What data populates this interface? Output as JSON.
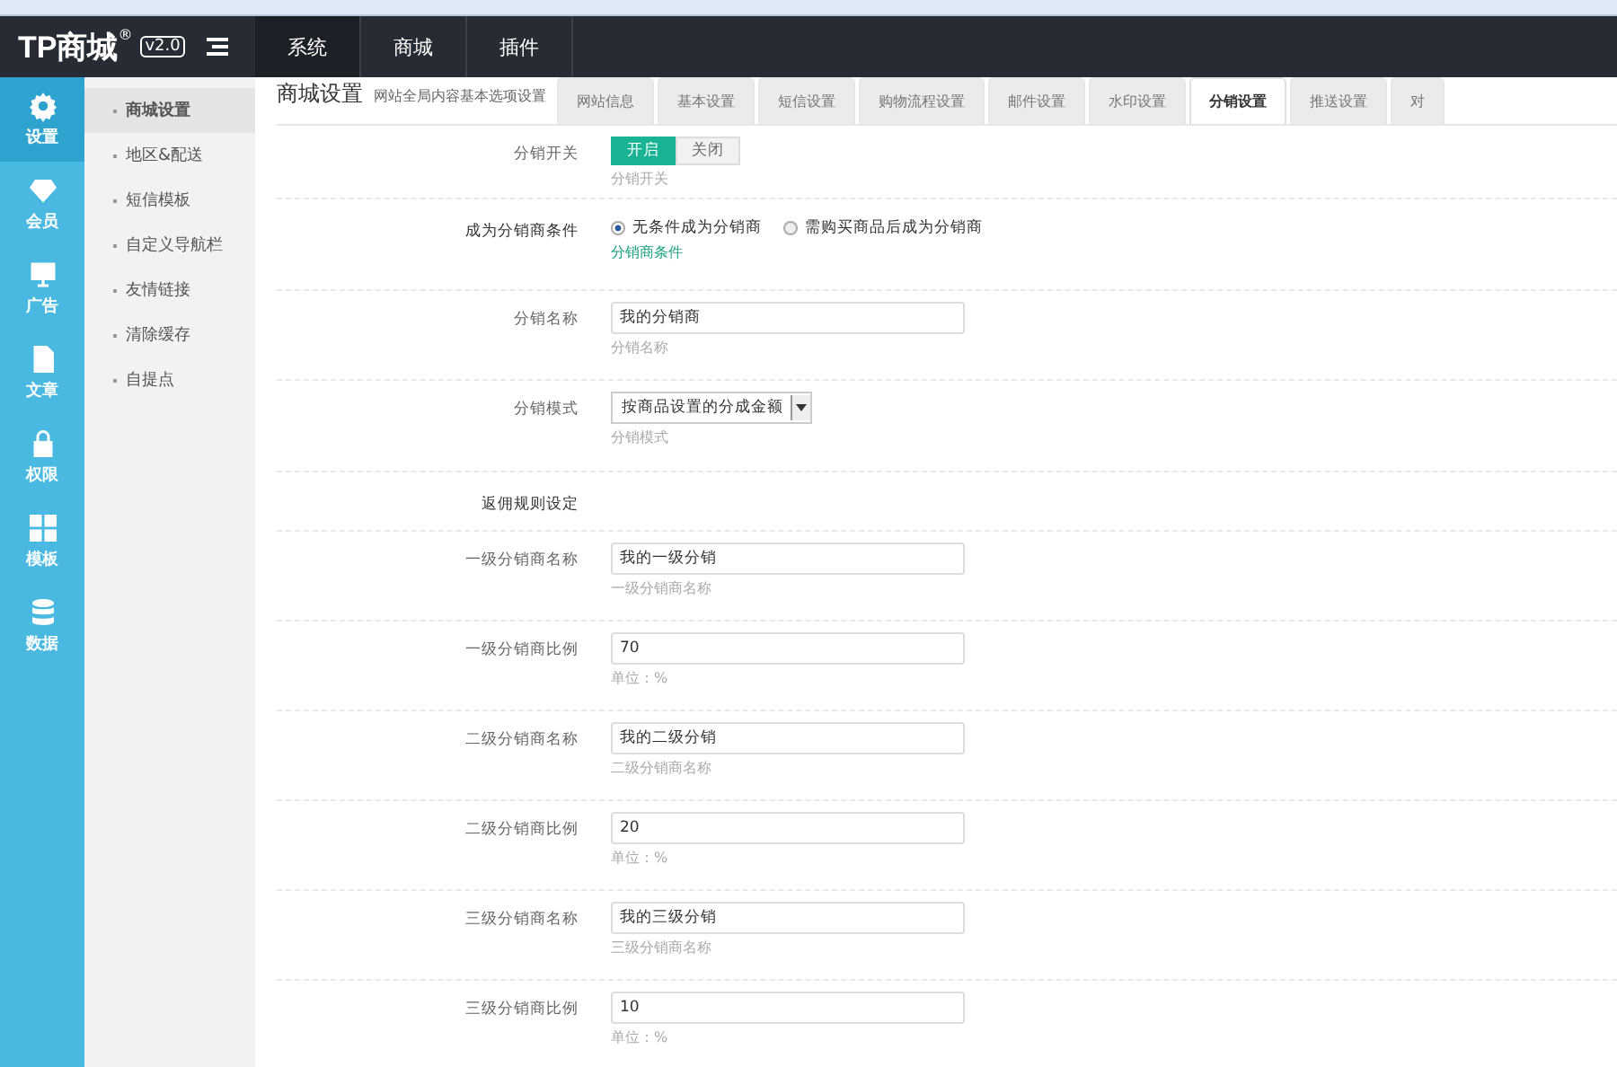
{
  "topbar": {
    "logo": "TP商城",
    "logo_mark": "®",
    "version": "v2.0",
    "menu": [
      {
        "label": "系统",
        "selected": true
      },
      {
        "label": "商城",
        "selected": false
      },
      {
        "label": "插件",
        "selected": false
      }
    ]
  },
  "iconbar": [
    {
      "label": "设置",
      "selected": true
    },
    {
      "label": "会员",
      "selected": false
    },
    {
      "label": "广告",
      "selected": false
    },
    {
      "label": "文章",
      "selected": false
    },
    {
      "label": "权限",
      "selected": false
    },
    {
      "label": "模板",
      "selected": false
    },
    {
      "label": "数据",
      "selected": false
    }
  ],
  "submenu": [
    {
      "label": "商城设置",
      "selected": true
    },
    {
      "label": "地区&配送",
      "selected": false
    },
    {
      "label": "短信模板",
      "selected": false
    },
    {
      "label": "自定义导航栏",
      "selected": false
    },
    {
      "label": "友情链接",
      "selected": false
    },
    {
      "label": "清除缓存",
      "selected": false
    },
    {
      "label": "自提点",
      "selected": false
    }
  ],
  "page": {
    "title": "商城设置",
    "subtitle": "网站全局内容基本选项设置"
  },
  "tabs": [
    {
      "label": "网站信息",
      "selected": false
    },
    {
      "label": "基本设置",
      "selected": false
    },
    {
      "label": "短信设置",
      "selected": false
    },
    {
      "label": "购物流程设置",
      "selected": false
    },
    {
      "label": "邮件设置",
      "selected": false
    },
    {
      "label": "水印设置",
      "selected": false
    },
    {
      "label": "分销设置",
      "selected": true
    },
    {
      "label": "推送设置",
      "selected": false
    },
    {
      "label": "对",
      "selected": false
    }
  ],
  "form": [
    {
      "kind": "toggle",
      "label": "分销开关",
      "options": [
        {
          "label": "开启",
          "selected": true
        },
        {
          "label": "关闭",
          "selected": false
        }
      ],
      "hint": "分销开关"
    },
    {
      "kind": "radio",
      "label": "成为分销商条件",
      "options": [
        {
          "label": "无条件成为分销商",
          "selected": true
        },
        {
          "label": "需购买商品后成为分销商",
          "selected": false
        }
      ],
      "hint": "分销商条件"
    },
    {
      "kind": "text",
      "label": "分销名称",
      "value": "我的分销商",
      "hint": "分销名称"
    },
    {
      "kind": "select",
      "label": "分销模式",
      "value": "按商品设置的分成金额",
      "hint": "分销模式"
    },
    {
      "kind": "header",
      "label": "返佣规则设定"
    },
    {
      "kind": "text",
      "label": "一级分销商名称",
      "value": "我的一级分销",
      "hint": "一级分销商名称"
    },
    {
      "kind": "text",
      "label": "一级分销商比例",
      "value": "70",
      "hint": "单位：%"
    },
    {
      "kind": "text",
      "label": "二级分销商名称",
      "value": "我的二级分销",
      "hint": "二级分销商名称"
    },
    {
      "kind": "text",
      "label": "二级分销商比例",
      "value": "20",
      "hint": "单位：%"
    },
    {
      "kind": "text",
      "label": "三级分销商名称",
      "value": "我的三级分销",
      "hint": "三级分销商名称"
    },
    {
      "kind": "text",
      "label": "三级分销商比例",
      "value": "10",
      "hint": "单位：%"
    }
  ]
}
